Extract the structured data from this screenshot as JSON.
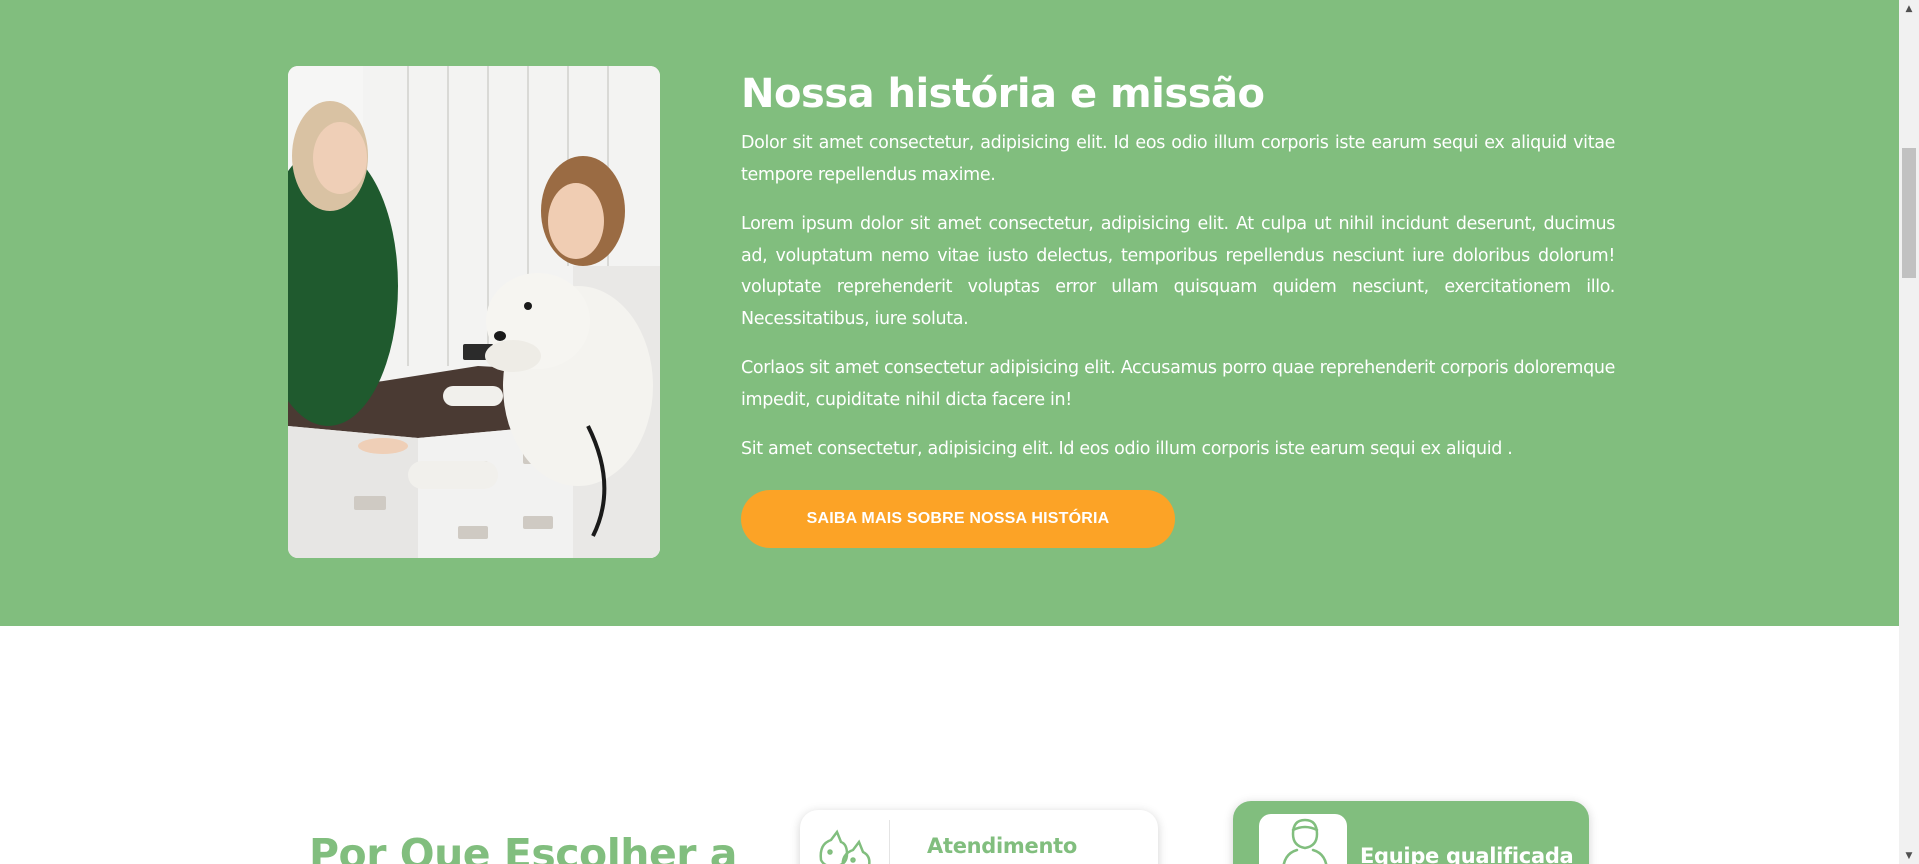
{
  "about": {
    "background_color": "#81be7e",
    "photo_alt": "image",
    "title": "Nossa história e missão",
    "paragraphs": [
      "Dolor sit amet consectetur, adipisicing elit. Id eos odio illum corporis iste earum sequi ex aliquid vitae tempore repellendus maxime.",
      "Lorem ipsum dolor sit amet consectetur, adipisicing elit. At culpa ut nihil incidunt deserunt, ducimus ad, voluptatum nemo vitae iusto delectus, temporibus repellendus nesciunt iure doloribus dolorum! voluptate reprehenderit voluptas error ullam quisquam quidem nesciunt, exercitationem illo. Necessitatibus, iure soluta.",
      "Corlaos sit amet consectetur adipisicing elit. Accusamus porro quae reprehenderit corporis doloremque impedit, cupiditate nihil dicta facere in!",
      "Sit amet consectetur, adipisicing elit. Id eos odio illum corporis iste earum sequi ex aliquid ."
    ],
    "cta_label": "SAIBA MAIS SOBRE NOSSA HISTÓRIA",
    "cta_color": "#fca326"
  },
  "why": {
    "title": "Por Que Escolher a",
    "cards": [
      {
        "title": "Atendimento",
        "icon": "pets-icon"
      },
      {
        "title": "Equipe qualificada",
        "icon": "vet-person-icon"
      }
    ]
  },
  "scrollbar": {
    "up_icon": "arrow-up-icon",
    "down_icon": "arrow-down-icon"
  }
}
